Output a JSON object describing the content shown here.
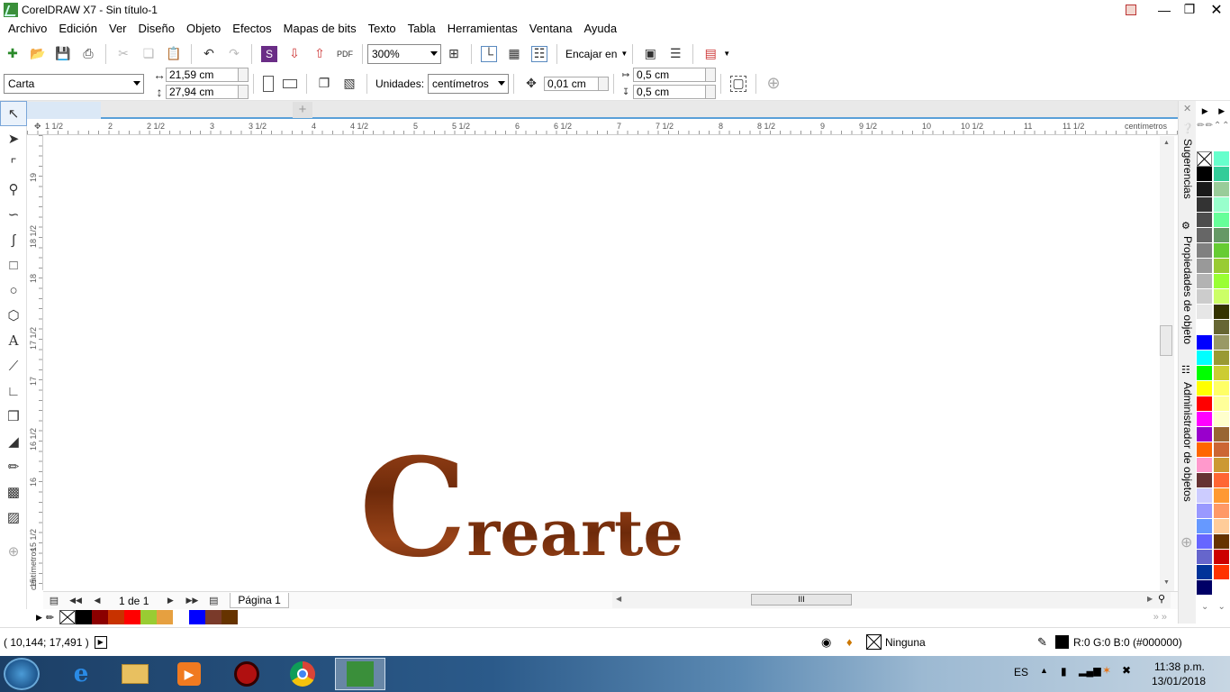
{
  "window": {
    "title": "CorelDRAW X7 - Sin título-1"
  },
  "menu": [
    "Archivo",
    "Edición",
    "Ver",
    "Diseño",
    "Objeto",
    "Efectos",
    "Mapas de bits",
    "Texto",
    "Tabla",
    "Herramientas",
    "Ventana",
    "Ayuda"
  ],
  "toolbar": {
    "zoom": "300%",
    "snap": "Encajar en"
  },
  "propbar": {
    "page_size": "Carta",
    "width": "21,59 cm",
    "height": "27,94 cm",
    "units_label": "Unidades:",
    "units": "centímetros",
    "nudge": "0,01 cm",
    "dup_x": "0,5 cm",
    "dup_y": "0,5 cm"
  },
  "rulers": {
    "h_labels": [
      "1 1/2",
      "2",
      "2 1/2",
      "3",
      "3 1/2",
      "4",
      "4 1/2",
      "5",
      "5 1/2",
      "6",
      "6 1/2",
      "7",
      "7 1/2",
      "8",
      "8 1/2",
      "9",
      "9 1/2",
      "10",
      "10 1/2",
      "11",
      "11 1/2"
    ],
    "h_unit": "centímetros",
    "v_labels": [
      "19",
      "18 1/2",
      "18",
      "17 1/2",
      "17",
      "16 1/2",
      "16",
      "15 1/2",
      "15"
    ],
    "v_unit": "centímetros"
  },
  "canvas": {
    "artwork_letter": "C",
    "artwork_rest": "rearte"
  },
  "pagebar": {
    "page_count": "1 de 1",
    "page_tab": "Página 1"
  },
  "dockers": {
    "hints": "Sugerencias",
    "properties": "Propiedades de objeto",
    "objects": "Administrador de objetos"
  },
  "palette_colors_1": [
    "#000000",
    "#1a1a1a",
    "#333333",
    "#4d4d4d",
    "#666666",
    "#808080",
    "#999999",
    "#b3b3b3",
    "#cccccc",
    "#e6e6e6",
    "#ffffff",
    "#0000ff",
    "#00ffff",
    "#00ff00",
    "#ffff00",
    "#ff0000",
    "#ff00ff",
    "#9900cc",
    "#ff6600",
    "#ff99cc",
    "#663333",
    "#ccccff",
    "#9999ff",
    "#6699ff",
    "#6666ff",
    "#6666cc",
    "#003399",
    "#000066"
  ],
  "palette_colors_2": [
    "#66ffcc",
    "#33cc99",
    "#99cc99",
    "#99ffcc",
    "#66ff99",
    "#669966",
    "#66cc33",
    "#99cc33",
    "#99ff33",
    "#ccff66",
    "#333300",
    "#666633",
    "#999966",
    "#999933",
    "#cccc33",
    "#ffff66",
    "#ffff99",
    "#ffffcc",
    "#996633",
    "#cc6633",
    "#cc9933",
    "#ff6633",
    "#ff9933",
    "#ff9966",
    "#ffcc99",
    "#663300",
    "#cc0000",
    "#ff3300"
  ],
  "doc_palette": [
    "#000000",
    "#8b0000",
    "#c83200",
    "#ff0000",
    "#99cc33",
    "#e6a040",
    "#ffffff",
    "#0000ff",
    "#7a3a2a",
    "#663300"
  ],
  "status": {
    "coords": "( 10,144; 17,491 )",
    "fill": "Ninguna",
    "outline": "R:0 G:0 B:0 (#000000)"
  },
  "taskbar": {
    "lang": "ES",
    "time": "11:38 p.m.",
    "date": "13/01/2018"
  }
}
